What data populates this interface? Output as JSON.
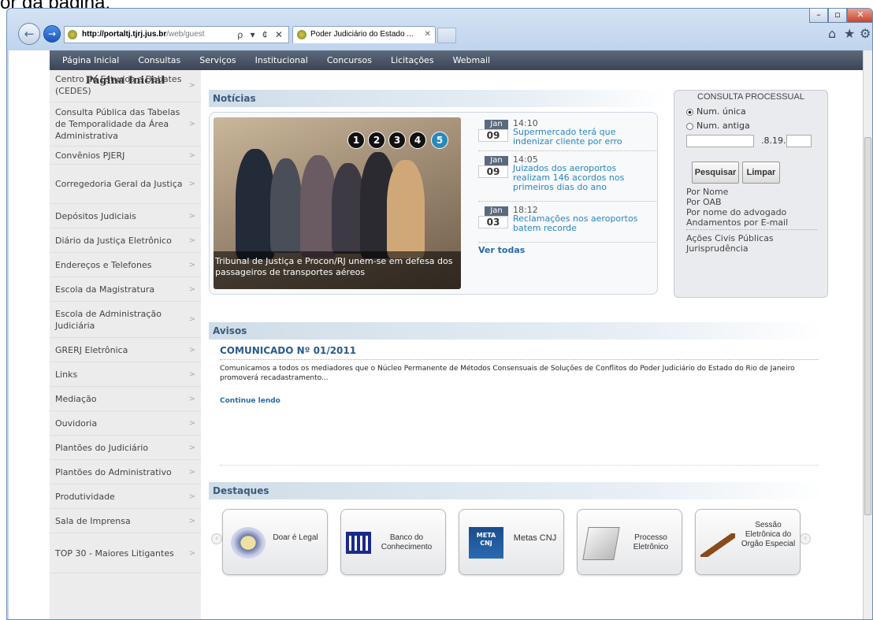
{
  "caption": "or da página.",
  "browser": {
    "url_host": "http://portaltj.tjrj.jus.br",
    "url_rest": "/web/guest",
    "url_controls": "ρ ▾ ¢ ✕",
    "tab_title": "Poder Judiciário do Estado ...",
    "tab_close": "✕",
    "back_glyph": "←",
    "forward_glyph": "→",
    "minimize": "–",
    "restore": "▫",
    "close": "✕",
    "home_icon": "⌂",
    "favorites_icon": "★",
    "tools_icon": "⚙"
  },
  "topnav": [
    "Página Inicial",
    "Consultas",
    "Serviços",
    "Institucional",
    "Concursos",
    "Licitações",
    "Webmail"
  ],
  "sidebar": {
    "title": "Página Inicial",
    "items": [
      "Centro de Estudos e Debates (CEDES)",
      "Consulta Pública das Tabelas de Temporalidade da Área Administrativa",
      "Convênios PJERJ",
      "Corregedoria Geral da Justiça",
      "Depósitos Judiciais",
      "Diário da Justiça Eletrônico",
      "Endereços e Telefones",
      "Escola da Magistratura",
      "Escola de Administração Judiciária",
      "GRERJ Eletrônica",
      "Links",
      "Mediação",
      "Ouvidoria",
      "Plantões do Judiciário",
      "Plantões do Administrativo",
      "Produtividade",
      "Sala de Imprensa",
      "TOP 30 - Maiores Litigantes"
    ],
    "chevron": ">"
  },
  "noticias": {
    "title": "Notícias",
    "photo_caption": "Tribunal de Justiça e Procon/RJ unem-se em defesa dos passageiros de transportes aéreos",
    "slides": [
      "1",
      "2",
      "3",
      "4",
      "5"
    ],
    "items": [
      {
        "month": "Jan",
        "day": "09",
        "time": "14:10",
        "title": "Supermercado terá que indenizar cliente por erro"
      },
      {
        "month": "Jan",
        "day": "09",
        "time": "14:05",
        "title": "Juizados dos aeroportos realizam 146 acordos nos primeiros dias do ano"
      },
      {
        "month": "Jan",
        "day": "03",
        "time": "18:12",
        "title": "Reclamações nos aeroportos batem recorde"
      }
    ],
    "ver_todas": "Ver todas"
  },
  "consulta": {
    "title": "CONSULTA PROCESSUAL",
    "radio1": "Num. única",
    "radio2": "Num. antiga",
    "mid": ".8.19.",
    "search": "Pesquisar",
    "clear": "Limpar",
    "links1": [
      "Por Nome",
      "Por OAB",
      "Por nome do advogado",
      "Andamentos por E-mail"
    ],
    "links2": [
      "Ações Civis Públicas",
      "Jurisprudência"
    ]
  },
  "avisos": {
    "title": "Avisos",
    "heading": "COMUNICADO Nº 01/2011",
    "text": "Comunicamos a todos os mediadores que o Núcleo Permanente de Métodos Consensuais de Soluções de Conflitos do Poder Judiciário do Estado do Rio de Janeiro promoverá recadastramento...",
    "more": "Continue lendo"
  },
  "destaques": {
    "title": "Destaques",
    "items": [
      "Doar é Legal",
      "Banco do Conhecimento",
      "Metas CNJ",
      "Processo Eletrônico",
      "Sessão Eletrônica do Orgão Especial"
    ],
    "meta_logo": "META",
    "cnj_logo": "CNJ"
  }
}
